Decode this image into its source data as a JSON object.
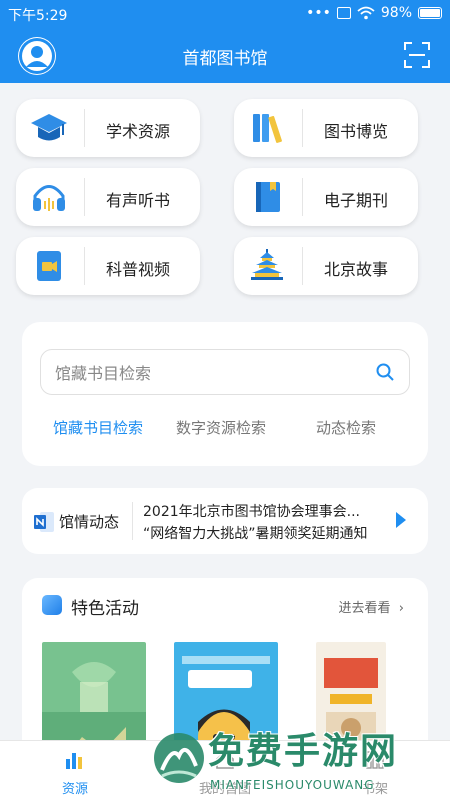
{
  "status_bar": {
    "time": "下午5:29",
    "dots": "•••",
    "battery": "98%"
  },
  "app_bar": {
    "title": "首都图书馆"
  },
  "quick_tiles": [
    {
      "label": "学术资源",
      "icon": "graduation-cap-icon"
    },
    {
      "label": "图书博览",
      "icon": "books-icon"
    },
    {
      "label": "有声听书",
      "icon": "headphones-icon"
    },
    {
      "label": "电子期刊",
      "icon": "ebook-icon"
    },
    {
      "label": "科普视频",
      "icon": "video-icon"
    },
    {
      "label": "北京故事",
      "icon": "temple-of-heaven-icon"
    }
  ],
  "search": {
    "placeholder": "馆藏书目检索",
    "tabs": [
      "馆藏书目检索",
      "数字资源检索",
      "动态检索"
    ],
    "active_tab": 0
  },
  "news": {
    "label": "馆情动态",
    "items": [
      "2021年北京市图书馆协会理事会...",
      "“网络智力大挑战”暑期领奖延期通知"
    ]
  },
  "featured": {
    "title": "特色活动",
    "more": "进去看看"
  },
  "bottom_nav": [
    {
      "label": "资源",
      "icon": "resources-icon",
      "active": true
    },
    {
      "label": "我的首图",
      "icon": "home-icon",
      "active": false
    },
    {
      "label": "书架",
      "icon": "bookshelf-icon",
      "active": false
    }
  ],
  "watermark": {
    "cn": "免费手游网",
    "en": "MIANFEISHOUYOUWANG"
  },
  "colors": {
    "primary": "#1f8ef0",
    "background": "#f2f4f7",
    "watermark": "#2a8a6a"
  }
}
